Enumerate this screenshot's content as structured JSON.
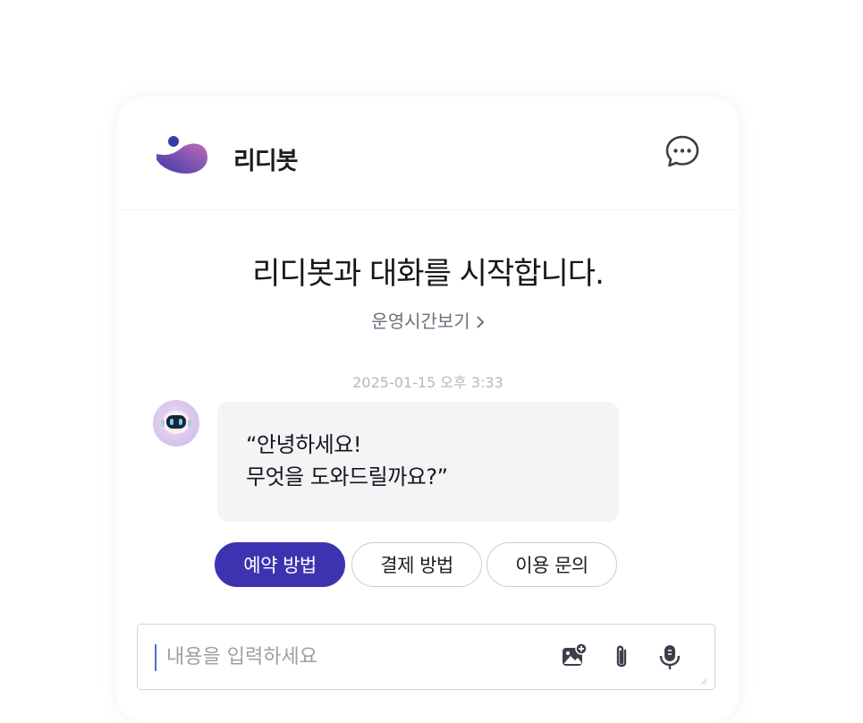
{
  "header": {
    "bot_name": "리디봇",
    "logo_icon": "ridi-logo",
    "chat_icon": "chat-bubble-icon"
  },
  "welcome": {
    "title": "리디봇과 대화를 시작합니다.",
    "hours_link": "운영시간보기"
  },
  "conversation": {
    "timestamp": "2025-01-15 오후 3:33",
    "messages": [
      {
        "sender": "bot",
        "avatar_icon": "robot-avatar-icon",
        "lines": [
          "“안녕하세요!",
          "무엇을 도와드릴까요?”"
        ]
      }
    ]
  },
  "quick_replies": [
    {
      "label": "예약 방법",
      "selected": true
    },
    {
      "label": "결제 방법",
      "selected": false
    },
    {
      "label": "이용 문의",
      "selected": false
    }
  ],
  "composer": {
    "value": "",
    "placeholder": "내용을 입력하세요",
    "tools": [
      "image-upload-icon",
      "paperclip-icon",
      "microphone-icon"
    ]
  },
  "colors": {
    "accent": "#3d33b0",
    "logo_gradient_start": "#3a3aa8",
    "logo_gradient_end": "#c06bb8",
    "bubble_bg": "#f3f4f6",
    "caret": "#4a6bd6"
  }
}
